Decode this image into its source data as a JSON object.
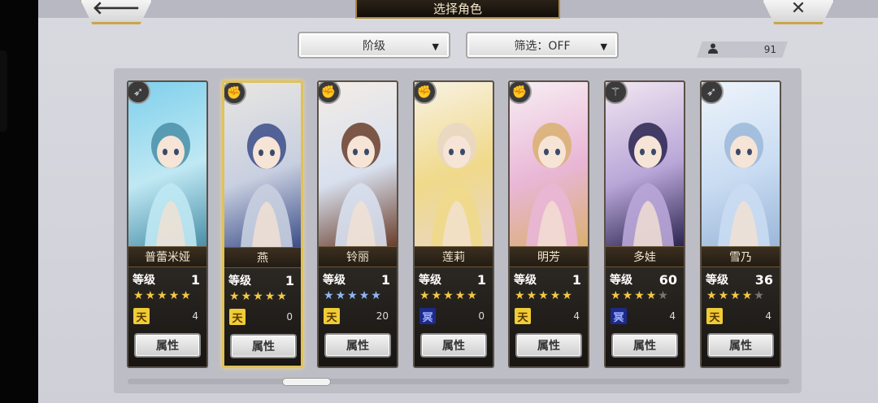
{
  "header": {
    "title": "选择角色",
    "back_glyph": "🡐",
    "close_glyph": "✕"
  },
  "filters": {
    "rank_label": "阶级",
    "filter_label": "筛选：OFF",
    "caret": "▼"
  },
  "count": {
    "icon": "person-icon",
    "value": "91"
  },
  "colors": {
    "gold_border": "#c9a64a",
    "selected_border": "#e0c15c",
    "star_gold": "#f4c845",
    "star_blue": "#8fb6f4"
  },
  "common": {
    "level_label": "等级",
    "attr_label": "属性"
  },
  "characters": [
    {
      "name": "普蕾米娅",
      "level": "1",
      "stars": [
        "gold",
        "gold",
        "gold",
        "gold",
        "gold"
      ],
      "rank_badge": "天",
      "rank_color": "gold",
      "rank_count": "4",
      "type_icon": "bow-icon",
      "selected": false,
      "art": [
        "#7fd0ec",
        "#bfe8f3",
        "#4a8fa8"
      ]
    },
    {
      "name": "燕",
      "level": "1",
      "stars": [
        "gold",
        "gold",
        "gold",
        "gold",
        "gold"
      ],
      "rank_badge": "天",
      "rank_color": "gold",
      "rank_count": "0",
      "type_icon": "fist-icon",
      "selected": true,
      "art": [
        "#e8e6e2",
        "#c8cfe0",
        "#3c4e88"
      ]
    },
    {
      "name": "铃丽",
      "level": "1",
      "stars": [
        "blue",
        "blue",
        "blue",
        "blue",
        "blue"
      ],
      "rank_badge": "天",
      "rank_color": "gold",
      "rank_count": "20",
      "type_icon": "fist-icon",
      "selected": false,
      "art": [
        "#f3ece6",
        "#d8e0ee",
        "#6a3d2a"
      ]
    },
    {
      "name": "莲莉",
      "level": "1",
      "stars": [
        "gold",
        "gold",
        "gold",
        "gold",
        "gold"
      ],
      "rank_badge": "冥",
      "rank_color": "navy",
      "rank_count": "0",
      "type_icon": "fist-icon",
      "selected": false,
      "art": [
        "#f8f2e3",
        "#f0d98a",
        "#e8d7c4"
      ]
    },
    {
      "name": "明芳",
      "level": "1",
      "stars": [
        "gold",
        "gold",
        "gold",
        "gold",
        "gold"
      ],
      "rank_badge": "天",
      "rank_color": "gold",
      "rank_count": "4",
      "type_icon": "fist-icon",
      "selected": false,
      "art": [
        "#f7eef3",
        "#e9b6d6",
        "#d9b070"
      ]
    },
    {
      "name": "多娃",
      "level": "60",
      "stars": [
        "gold",
        "gold",
        "gold",
        "gold",
        "gray"
      ],
      "rank_badge": "冥",
      "rank_color": "navy",
      "rank_count": "4",
      "type_icon": "staff-icon",
      "selected": false,
      "art": [
        "#f2e6f0",
        "#b9a6d8",
        "#2a2550"
      ]
    },
    {
      "name": "雪乃",
      "level": "36",
      "stars": [
        "gold",
        "gold",
        "gold",
        "gold",
        "gray"
      ],
      "rank_badge": "天",
      "rank_color": "gold",
      "rank_count": "4",
      "type_icon": "bow-icon",
      "selected": false,
      "art": [
        "#eef4fb",
        "#c9dcf2",
        "#9bb7d9"
      ]
    }
  ]
}
